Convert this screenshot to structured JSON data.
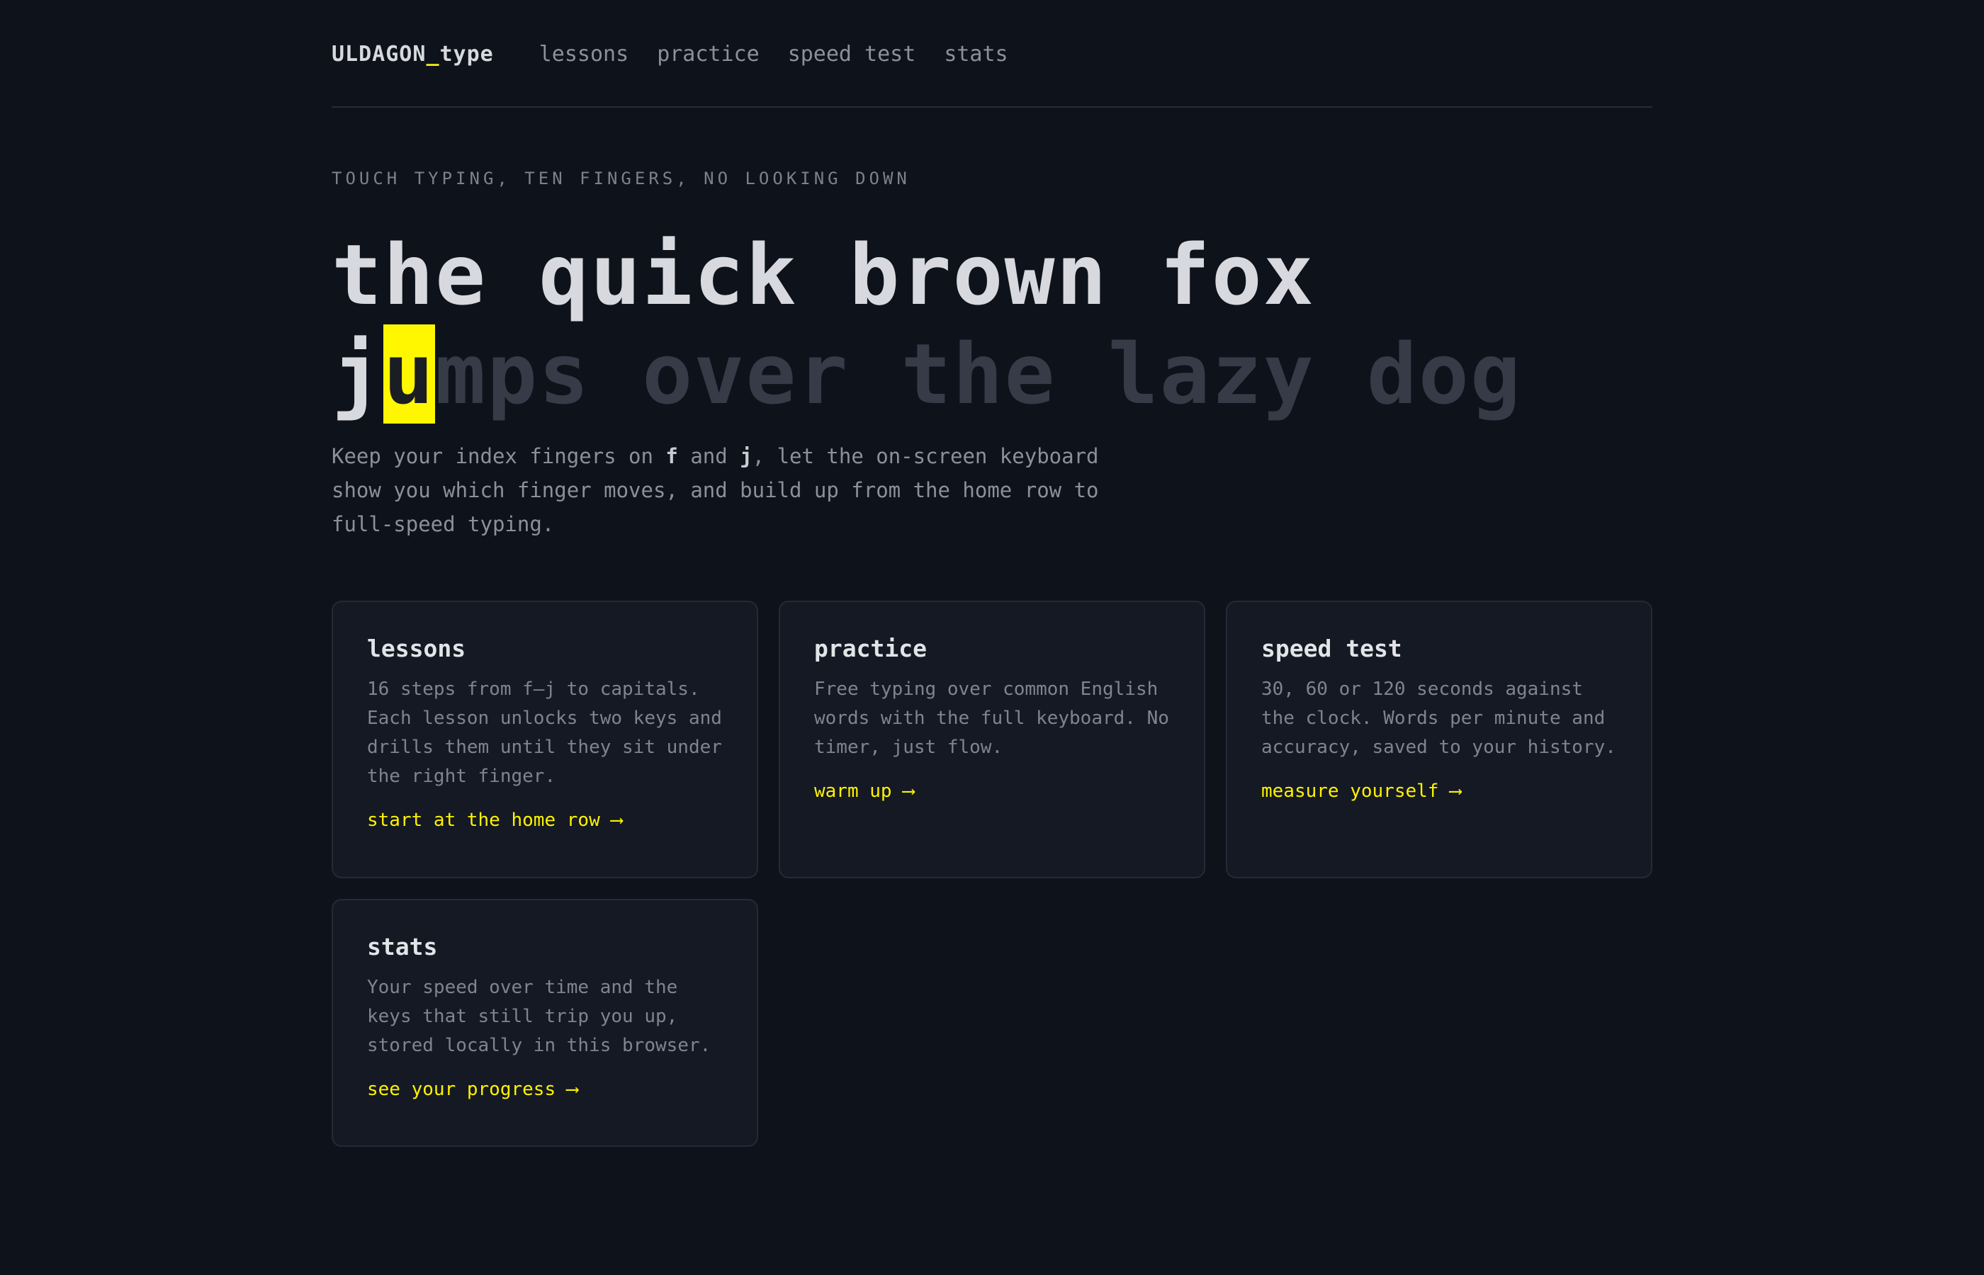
{
  "nav": {
    "brand_prefix": "ULDAGON",
    "brand_underscore": "_",
    "brand_suffix": "type",
    "links": [
      "lessons",
      "practice",
      "speed test",
      "stats"
    ]
  },
  "hero": {
    "kicker": "TOUCH TYPING, TEN FINGERS, NO LOOKING DOWN",
    "line1": "the quick brown fox",
    "line2_typed": "j",
    "line2_cursor": "u",
    "line2_pending": "mps over the lazy dog",
    "lead_part1": "Keep your index fingers on ",
    "lead_key1": "f",
    "lead_part2": " and ",
    "lead_key2": "j",
    "lead_part3": ", let the on-screen keyboard show you which finger moves, and build up from the home row to full-speed typing."
  },
  "cards": [
    {
      "title": "lessons",
      "desc": "16 steps from f–j to capitals. Each lesson unlocks two keys and drills them until they sit under the right finger.",
      "cta": "start at the home row ⟶"
    },
    {
      "title": "practice",
      "desc": "Free typing over common English words with the full keyboard. No timer, just flow.",
      "cta": "warm up ⟶"
    },
    {
      "title": "speed test",
      "desc": "30, 60 or 120 seconds against the clock. Words per minute and accuracy, saved to your history.",
      "cta": "measure yourself ⟶"
    },
    {
      "title": "stats",
      "desc": "Your speed over time and the keys that still trip you up, stored locally in this browser.",
      "cta": "see your progress ⟶"
    }
  ],
  "colors": {
    "background": "#0e121a",
    "accent": "#fff200",
    "cursor_bg": "#fff700",
    "card_bg": "#141924"
  }
}
